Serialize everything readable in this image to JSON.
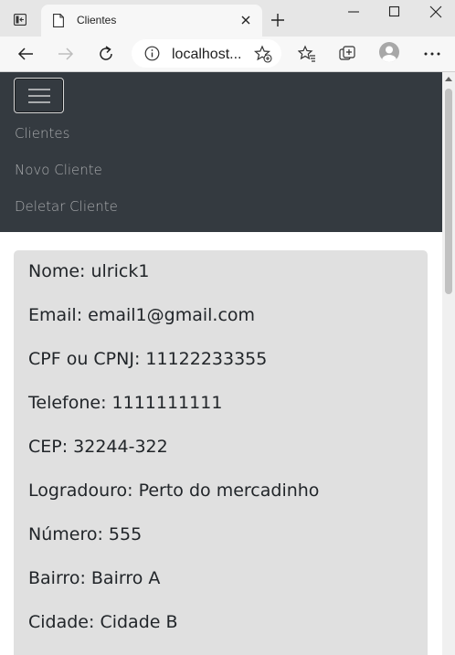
{
  "browser": {
    "tab_title": "Clientes",
    "url": "localhost..."
  },
  "navbar": {
    "links": [
      "Clientes",
      "Novo Cliente",
      "Deletar Cliente"
    ]
  },
  "client": {
    "fields": [
      "Nome: ulrick1",
      "Email: email1@gmail.com",
      "CPF ou CPNJ: 11122233355",
      "Telefone: 1111111111",
      "CEP: 32244-322",
      "Logradouro: Perto do mercadinho",
      "Número: 555",
      "Bairro: Bairro A",
      "Cidade: Cidade B"
    ]
  },
  "icons": {
    "tab_actions": "tab-actions-icon",
    "favicon": "page-icon",
    "close_tab": "close-icon",
    "new_tab": "plus-icon",
    "back": "arrow-left-icon",
    "forward": "arrow-right-icon",
    "refresh": "refresh-icon",
    "site_info": "info-icon",
    "add_favorite": "star-plus-icon",
    "favorites": "favorites-icon",
    "collections": "collections-icon",
    "profile": "avatar-icon",
    "more": "more-icon",
    "menu": "hamburger-icon"
  },
  "colors": {
    "navbar_bg": "#343a40",
    "nav_link": "#a9abad",
    "card_bg": "#e0e0e0",
    "text": "#212529"
  }
}
